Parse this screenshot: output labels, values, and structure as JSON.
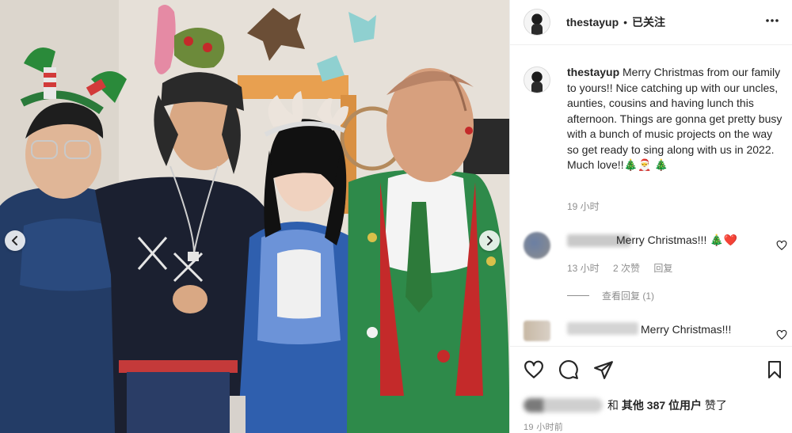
{
  "header": {
    "username": "thestayup",
    "separator": "•",
    "follow_status": "已关注"
  },
  "caption": {
    "username": "thestayup",
    "text": "Merry Christmas from our family to yours!! Nice catching up with our uncles, aunties, cousins and having lunch this afternoon. Things are gonna get pretty busy with a bunch of music projects on the way so get ready to sing along with us in 2022. Much love!!🎄🎅",
    "trailing_emoji": "🎄",
    "time": "19 小时"
  },
  "comments": [
    {
      "text": "Merry Christmas!!! 🎄❤️",
      "time": "13 小时",
      "likes": "2 次赞",
      "reply_label": "回复"
    },
    {
      "text": "Merry Christmas!!!"
    }
  ],
  "replies_toggle": "查看回复 (1)",
  "likes_summary": {
    "prefix": "和",
    "bold": "其他 387 位用户",
    "suffix": "赞了"
  },
  "post_time": "19 小时前",
  "icons": {
    "more": "more-horizontal-icon",
    "like": "heart-outline-icon",
    "comment": "comment-bubble-icon",
    "share": "paper-plane-icon",
    "save": "bookmark-icon",
    "prev": "chevron-left-icon",
    "next": "chevron-right-icon"
  }
}
